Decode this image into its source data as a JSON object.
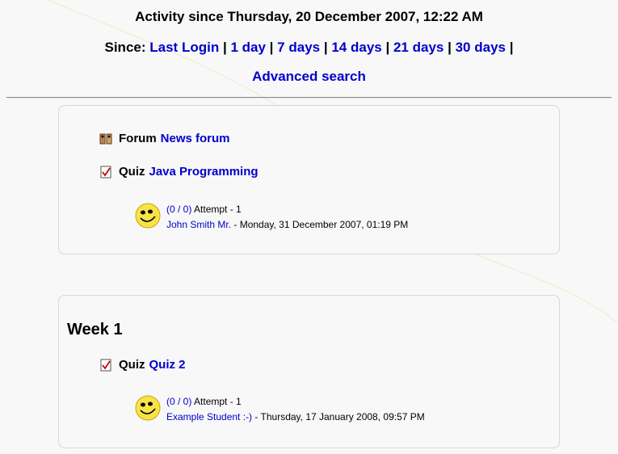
{
  "header": {
    "title": "Activity since Thursday, 20 December 2007, 12:22 AM",
    "since_label": "Since:",
    "since_links": [
      "Last Login",
      "1 day",
      "7 days",
      "14 days",
      "21 days",
      "30 days"
    ],
    "separator": "|",
    "advanced_search": "Advanced search"
  },
  "section1": {
    "activities": [
      {
        "module": "Forum",
        "name": "News forum",
        "icon": "forum-icon"
      },
      {
        "module": "Quiz",
        "name": "Java Programming",
        "icon": "quiz-icon"
      }
    ],
    "attempt": {
      "score": "(0 / 0)",
      "attempt_text": "Attempt - 1",
      "user": "John Smith Mr.",
      "when": "- Monday, 31 December 2007, 01:19 PM",
      "avatar": "smiley-face-icon"
    }
  },
  "section2": {
    "heading": "Week 1",
    "activities": [
      {
        "module": "Quiz",
        "name": "Quiz 2",
        "icon": "quiz-icon"
      }
    ],
    "attempt": {
      "score": "(0 / 0)",
      "attempt_text": "Attempt - 1",
      "user": "Example Student :-)",
      "when": "- Thursday, 17 January 2008, 09:57 PM",
      "avatar": "smiley-face-icon"
    }
  },
  "colors": {
    "link": "#0000cc",
    "background": "#f8f8f8",
    "border": "#d6d6d6"
  }
}
